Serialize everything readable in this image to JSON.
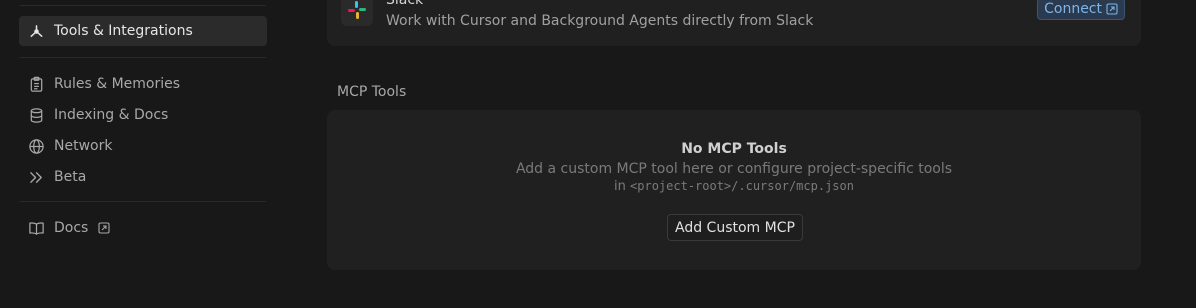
{
  "sidebar": {
    "items": [
      {
        "label": "Tools & Integrations",
        "icon": "tools-integrations-icon",
        "active": true
      },
      {
        "label": "Rules & Memories",
        "icon": "clipboard-icon"
      },
      {
        "label": "Indexing & Docs",
        "icon": "database-icon"
      },
      {
        "label": "Network",
        "icon": "globe-icon"
      },
      {
        "label": "Beta",
        "icon": "double-chevron-right-icon"
      },
      {
        "label": "Docs",
        "icon": "book-icon"
      }
    ]
  },
  "slack": {
    "title": "Slack",
    "description": "Work with Cursor and Background Agents directly from Slack",
    "connect_label": "Connect"
  },
  "mcp": {
    "section_title": "MCP Tools",
    "empty_title": "No MCP Tools",
    "empty_desc": "Add a custom MCP tool here or configure project-specific tools",
    "path_prefix": "in",
    "path": "<project-root>/.cursor/mcp.json",
    "add_label": "Add Custom MCP"
  },
  "colors": {
    "accent": "#7fb4e8",
    "background": "#181818",
    "card": "#202020"
  }
}
